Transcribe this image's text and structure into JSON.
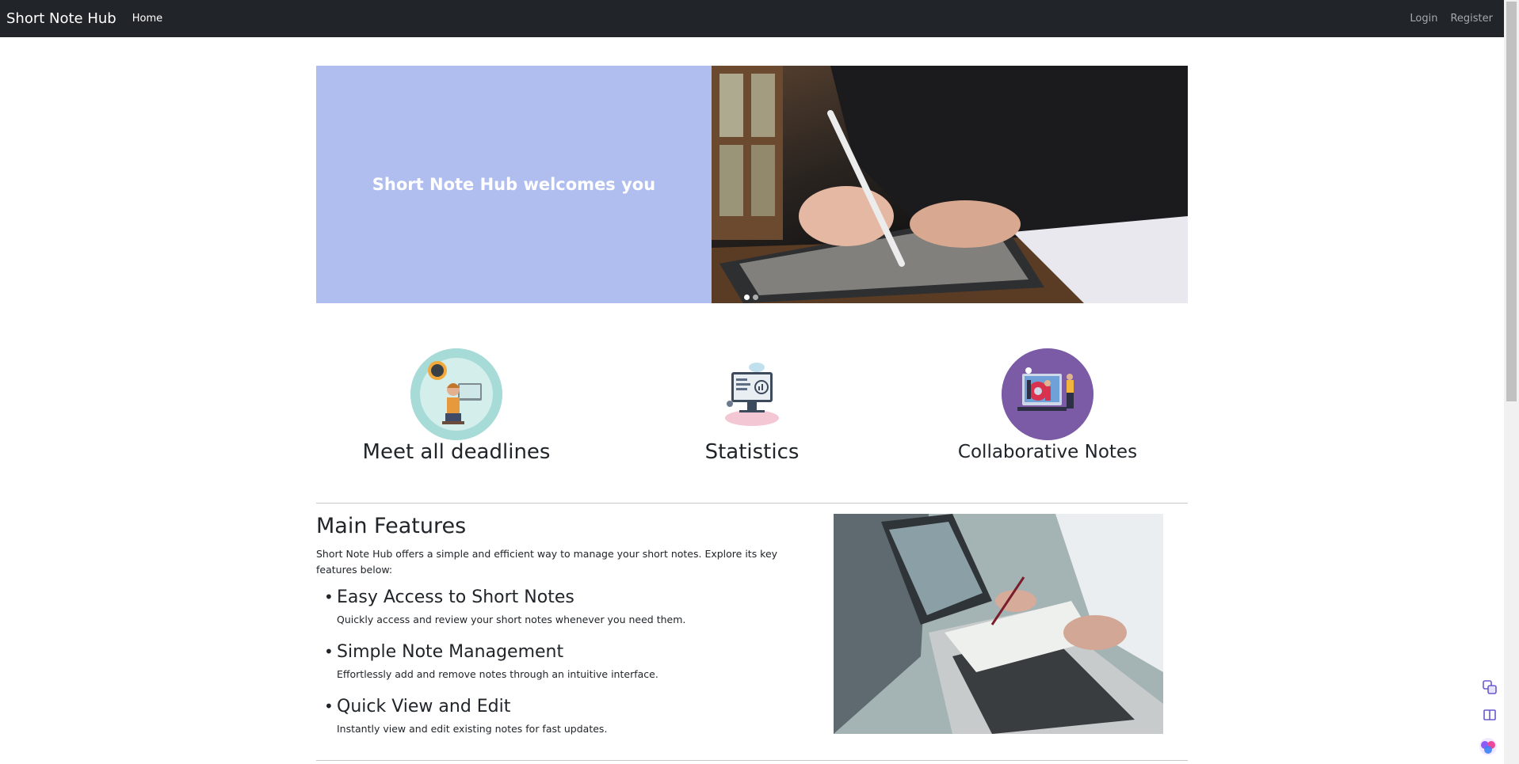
{
  "navbar": {
    "brand": "Short Note Hub",
    "home": "Home",
    "login": "Login",
    "register": "Register"
  },
  "carousel": {
    "title": "Short Note Hub welcomes you",
    "slide_count": 2,
    "active_slide": 1
  },
  "features": [
    {
      "title": "Meet all deadlines",
      "icon": "person-clock-illustration"
    },
    {
      "title": "Statistics",
      "icon": "computer-chart-illustration"
    },
    {
      "title": "Collaborative Notes",
      "icon": "team-gear-illustration"
    }
  ],
  "main_features": {
    "title": "Main Features",
    "intro": "Short Note Hub offers a simple and efficient way to manage your short notes. Explore its key features below:",
    "items": [
      {
        "heading": "Easy Access to Short Notes",
        "desc": "Quickly access and review your short notes whenever you need them."
      },
      {
        "heading": "Simple Note Management",
        "desc": "Effortlessly add and remove notes through an intuitive interface."
      },
      {
        "heading": "Quick View and Edit",
        "desc": "Instantly view and edit existing notes for fast updates."
      }
    ]
  },
  "colors": {
    "navbar": "#212529",
    "hero_panel": "#b0bdef",
    "accent_purple": "#7b5ba6"
  }
}
